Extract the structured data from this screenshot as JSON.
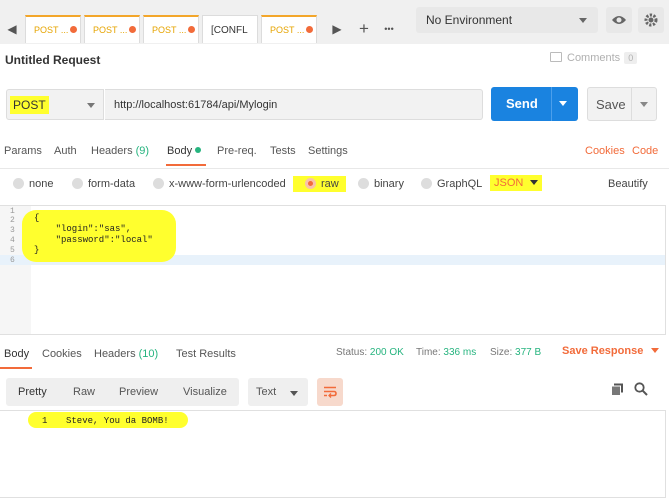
{
  "tabs": [
    {
      "label": "POST",
      "ellipsis": "..."
    },
    {
      "label": "POST",
      "ellipsis": "..."
    },
    {
      "label": "POST",
      "ellipsis": "..."
    },
    {
      "label": "[CONFL"
    },
    {
      "label": "POST",
      "ellipsis": "..."
    }
  ],
  "toolbar": {
    "add": "+",
    "more": "•••"
  },
  "environment": {
    "selected": "No Environment"
  },
  "request": {
    "title": "Untitled Request",
    "comments_label": "Comments",
    "comments_count": "0",
    "method": "POST",
    "url": "http://localhost:61784/api/Mylogin",
    "send_label": "Send",
    "save_label": "Save"
  },
  "request_tabs": {
    "params": "Params",
    "auth": "Auth",
    "headers": "Headers",
    "headers_count": "(9)",
    "body": "Body",
    "prereq": "Pre-req.",
    "tests": "Tests",
    "settings": "Settings",
    "cookies": "Cookies",
    "code": "Code"
  },
  "body_types": {
    "none": "none",
    "form_data": "form-data",
    "urlencoded": "x-www-form-urlencoded",
    "raw": "raw",
    "binary": "binary",
    "graphql": "GraphQL",
    "format": "JSON",
    "beautify": "Beautify",
    "selected": "raw"
  },
  "editor": {
    "line_numbers": [
      "1",
      "2",
      "3",
      "4",
      "5",
      "6"
    ],
    "lines": [
      "",
      "{",
      "    \"login\":\"sas\",",
      "    \"password\":\"local\"",
      "}",
      ""
    ]
  },
  "response_tabs": {
    "body": "Body",
    "cookies": "Cookies",
    "headers": "Headers",
    "headers_count": "(10)",
    "test_results": "Test Results"
  },
  "response_status": {
    "status_label": "Status:",
    "status_value": "200 OK",
    "time_label": "Time:",
    "time_value": "336 ms",
    "size_label": "Size:",
    "size_value": "377 B",
    "save_response": "Save Response"
  },
  "response_view": {
    "pretty": "Pretty",
    "raw": "Raw",
    "preview": "Preview",
    "visualize": "Visualize",
    "format": "Text"
  },
  "response_body": {
    "line_number": "1",
    "text": "Steve, You da BOMB!"
  },
  "colors": {
    "accent": "#f26b3a",
    "send": "#1a83e0",
    "success": "#26b47f",
    "highlight": "#ffff2e"
  }
}
